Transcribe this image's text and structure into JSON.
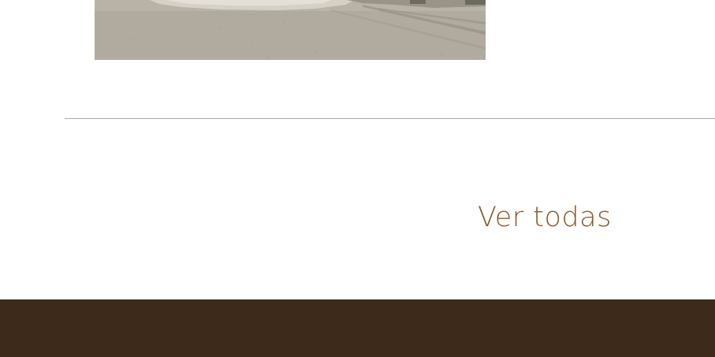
{
  "gallery": {
    "view_all_label": "Ver todas"
  },
  "colors": {
    "link": "#8a5a2b",
    "divider": "#a9a9a9",
    "footer_background": "#3e2a1b",
    "page_background": "#ffffff"
  }
}
